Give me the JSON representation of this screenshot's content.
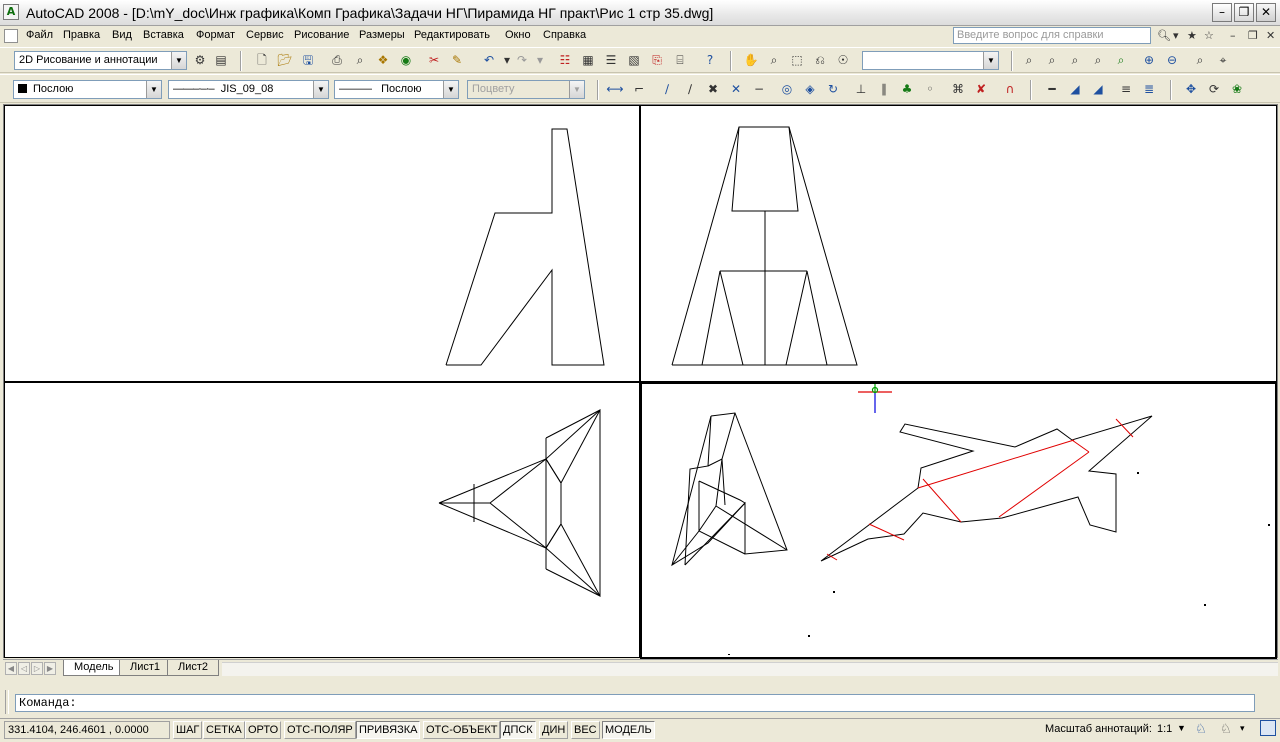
{
  "window": {
    "title": "AutoCAD 2008 - [D:\\mY_doc\\Инж графика\\Комп Графика\\Задачи НГ\\Пирамида НГ практ\\Рис 1 стр 35.dwg]",
    "minimize_icon": "minimize-icon",
    "restore_icon": "restore-icon",
    "close_icon": "close-icon"
  },
  "menubar": {
    "items": [
      {
        "label": "Файл",
        "id": "file"
      },
      {
        "label": "Правка",
        "id": "edit"
      },
      {
        "label": "Вид",
        "id": "view"
      },
      {
        "label": "Вставка",
        "id": "insert"
      },
      {
        "label": "Формат",
        "id": "format"
      },
      {
        "label": "Сервис",
        "id": "tools"
      },
      {
        "label": "Рисование",
        "id": "draw"
      },
      {
        "label": "Размеры",
        "id": "dimension"
      },
      {
        "label": "Редактировать",
        "id": "modify"
      },
      {
        "label": "Окно",
        "id": "window"
      },
      {
        "label": "Справка",
        "id": "help"
      }
    ],
    "help_placeholder": "Введите вопрос для справки"
  },
  "toolbar1": {
    "workspace": "2D Рисование и аннотации",
    "empty_combo": ""
  },
  "toolbar2": {
    "layer": "Послою",
    "linetype": "JIS_09_08",
    "lineweight": "Послою",
    "plotstyle": "Поцвету"
  },
  "tabs": [
    {
      "label": "Модель",
      "active": true
    },
    {
      "label": "Лист1",
      "active": false
    },
    {
      "label": "Лист2",
      "active": false
    }
  ],
  "command": {
    "prompt": "Команда:"
  },
  "status": {
    "coords": "331.4104, 246.4601 , 0.0000",
    "buttons": [
      {
        "label": "ШАГ",
        "on": false
      },
      {
        "label": "СЕТКА",
        "on": false
      },
      {
        "label": "ОРТО",
        "on": false
      },
      {
        "label": "ОТС-ПОЛЯР",
        "on": false
      },
      {
        "label": "ПРИВЯЗКА",
        "on": true
      },
      {
        "label": "ОТС-ОБЪЕКТ",
        "on": false
      },
      {
        "label": "ДПСК",
        "on": true
      },
      {
        "label": "ДИН",
        "on": false
      },
      {
        "label": "ВЕС",
        "on": false
      },
      {
        "label": "МОДЕЛЬ",
        "on": true
      }
    ],
    "annotation_scale_label": "Масштаб аннотаций:",
    "annotation_scale_value": "1:1"
  },
  "colors": {
    "section_line": "#E00000",
    "ucs_x": "#E00000",
    "ucs_y": "#009F00",
    "ucs_z": "#0000E0",
    "geometry": "#000000"
  }
}
